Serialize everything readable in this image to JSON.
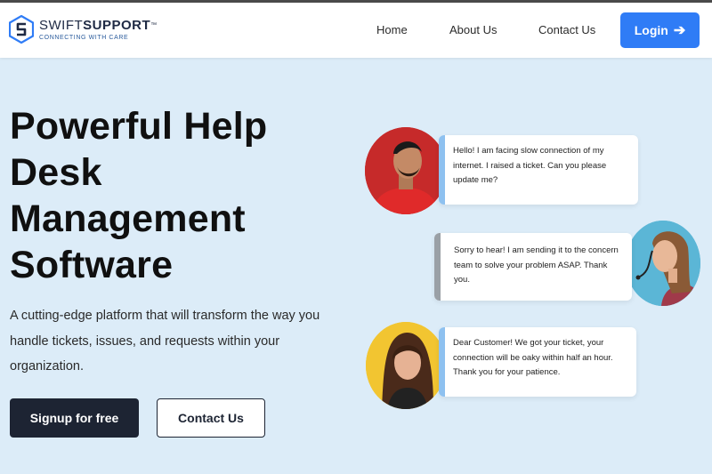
{
  "brand": {
    "name_light": "SWIFT",
    "name_bold": "SUPPORT",
    "trademark": "™",
    "tagline": "CONNECTING WITH CARE",
    "accent_color": "#2f7cf6"
  },
  "nav": {
    "items": [
      {
        "label": "Home"
      },
      {
        "label": "About Us"
      },
      {
        "label": "Contact Us"
      }
    ],
    "login_label": "Login",
    "login_icon": "arrow-right-icon"
  },
  "hero": {
    "title_lines": [
      "Powerful Help",
      "Desk",
      "Management",
      "Software"
    ],
    "description": "A cutting-edge platform that will transform the way you handle tickets, issues, and requests within your organization.",
    "signup_label": "Signup for free",
    "contact_label": "Contact Us"
  },
  "chat": [
    {
      "text": "Hello! I am facing slow connection of my internet. I raised a ticket. Can you please update me?",
      "avatar_bg": "#c62a2a"
    },
    {
      "text": "Sorry to hear! I am sending it to the concern team to solve your problem ASAP. Thank you.",
      "avatar_bg": "#5bb6d6"
    },
    {
      "text": "Dear Customer! We got your ticket, your connection will be oaky within half an hour. Thank you for your patience.",
      "avatar_bg": "#f2c531"
    }
  ]
}
